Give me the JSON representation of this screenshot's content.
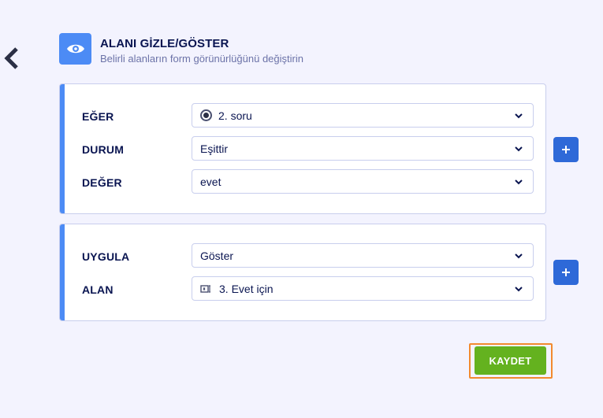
{
  "header": {
    "title": "ALANI GİZLE/GÖSTER",
    "subtitle": "Belirli alanların form görünürlüğünü değiştirin",
    "icon": "eye-icon",
    "accent_color": "#4c8bf5"
  },
  "condition": {
    "rows": [
      {
        "label": "EĞER",
        "value": "2. soru",
        "icon": "radio-button-icon"
      },
      {
        "label": "DURUM",
        "value": "Eşittir"
      },
      {
        "label": "DEĞER",
        "value": "evet"
      }
    ]
  },
  "action": {
    "rows": [
      {
        "label": "UYGULA",
        "value": "Göster"
      },
      {
        "label": "ALAN",
        "value": "3. Evet için",
        "icon": "field-icon"
      }
    ]
  },
  "save_label": "KAYDET",
  "save_color": "#64b21f",
  "plus_color": "#2e69d8"
}
